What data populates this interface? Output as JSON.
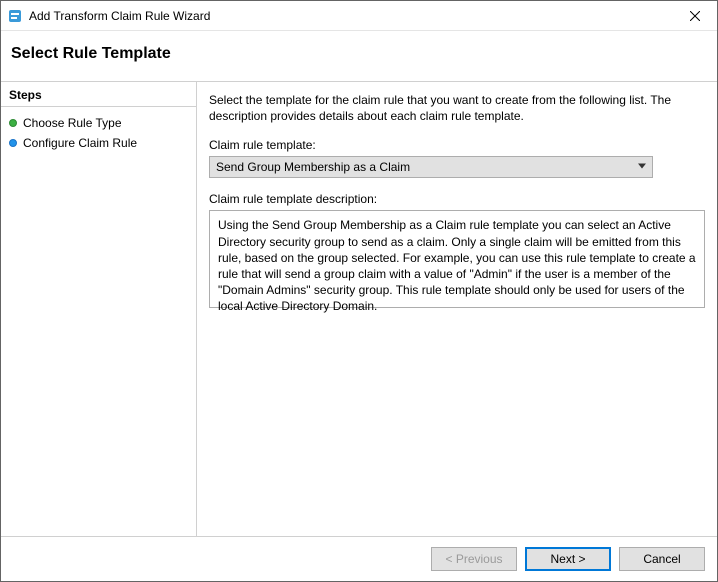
{
  "window": {
    "title": "Add Transform Claim Rule Wizard"
  },
  "header": {
    "title": "Select Rule Template"
  },
  "sidebar": {
    "header": "Steps",
    "items": [
      {
        "label": "Choose Rule Type",
        "state": "done"
      },
      {
        "label": "Configure Claim Rule",
        "state": "current"
      }
    ]
  },
  "main": {
    "intro": "Select the template for the claim rule that you want to create from the following list. The description provides details about each claim rule template.",
    "template_label": "Claim rule template:",
    "template_selected": "Send Group Membership as a Claim",
    "desc_label": "Claim rule template description:",
    "description": "Using the Send Group Membership as a Claim rule template you can select an Active Directory security group to send as a claim. Only a single claim will be emitted from this rule, based on the group selected. For example, you can use this rule template to create a rule that will send a group claim with a value of \"Admin\" if the user is a member of the \"Domain Admins\" security group.  This rule template should only be used for users of the local Active Directory Domain."
  },
  "footer": {
    "previous": "< Previous",
    "next": "Next >",
    "cancel": "Cancel"
  }
}
